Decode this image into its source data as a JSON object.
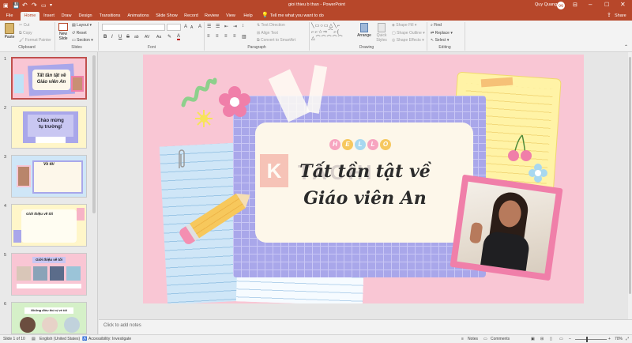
{
  "titlebar": {
    "doc_title": "gioi thieu b than",
    "app_sep": "-",
    "app_name": "PowerPoint",
    "user_name": "Quy Quang",
    "user_initials": "QQ"
  },
  "tabs": [
    "File",
    "Home",
    "Insert",
    "Draw",
    "Design",
    "Transitions",
    "Animations",
    "Slide Show",
    "Record",
    "Review",
    "View",
    "Help"
  ],
  "tellme": "Tell me what you want to do",
  "share": "Share",
  "ribbon": {
    "clipboard": {
      "paste": "Paste",
      "cut": "Cut",
      "copy": "Copy",
      "format_painter": "Format Painter",
      "label": "Clipboard"
    },
    "slides": {
      "new_slide": "New Slide",
      "layout": "Layout",
      "reset": "Reset",
      "section": "Section",
      "label": "Slides"
    },
    "font": {
      "label": "Font",
      "grow": "A",
      "shrink": "A",
      "clear": "A",
      "bold": "B",
      "italic": "I",
      "underline": "U",
      "strike": "S",
      "shadow": "ab",
      "spacing": "AV",
      "case": "Aa",
      "color": "A"
    },
    "paragraph": {
      "label": "Paragraph",
      "text_direction": "Text Direction",
      "align_text": "Align Text",
      "smartart": "Convert to SmartArt"
    },
    "drawing": {
      "label": "Drawing",
      "arrange": "Arrange",
      "quick_styles": "Quick Styles",
      "shape_fill": "Shape Fill",
      "shape_outline": "Shape Outline",
      "shape_effects": "Shape Effects"
    },
    "editing": {
      "label": "Editing",
      "find": "Find",
      "replace": "Replace",
      "select": "Select"
    }
  },
  "thumbnails": [
    {
      "num": "1",
      "title_line1": "Tất tần tật về",
      "title_line2": "Giáo viên An",
      "bg": "#f9c6d4"
    },
    {
      "num": "2",
      "title_line1": "Chào mừng",
      "title_line2": "tụ trường!",
      "bg": "#fff6c9"
    },
    {
      "num": "3",
      "title_line1": "Về tôi",
      "title_line2": "",
      "bg": "#cfe6f7"
    },
    {
      "num": "4",
      "title_line1": "Giới thiệu về tôi",
      "title_line2": "",
      "bg": "#fff6c9"
    },
    {
      "num": "5",
      "title_line1": "Giới thiệu về tôi",
      "title_line2": "",
      "bg": "#f9c6d4"
    },
    {
      "num": "6",
      "title_line1": "Những điều thú vị về tôi",
      "title_line2": "",
      "bg": "#d5f0c8"
    }
  ],
  "slide": {
    "hello_letters": [
      "H",
      "E",
      "L",
      "L",
      "O"
    ],
    "hello_colors": [
      "#f7a5c0",
      "#f6c85f",
      "#a8d8f0",
      "#f7a5c0",
      "#f6c85f"
    ],
    "title_line1": "Tất tần tật về",
    "title_line2": "Giáo viên An",
    "watermark_letter": "K",
    "watermark_text": "TACHI"
  },
  "notes_placeholder": "Click to add notes",
  "status": {
    "slide_of": "Slide 1 of 10",
    "language": "English (United States)",
    "accessibility": "Accessibility: Investigate",
    "notes": "Notes",
    "comments": "Comments",
    "zoom": "70%"
  }
}
